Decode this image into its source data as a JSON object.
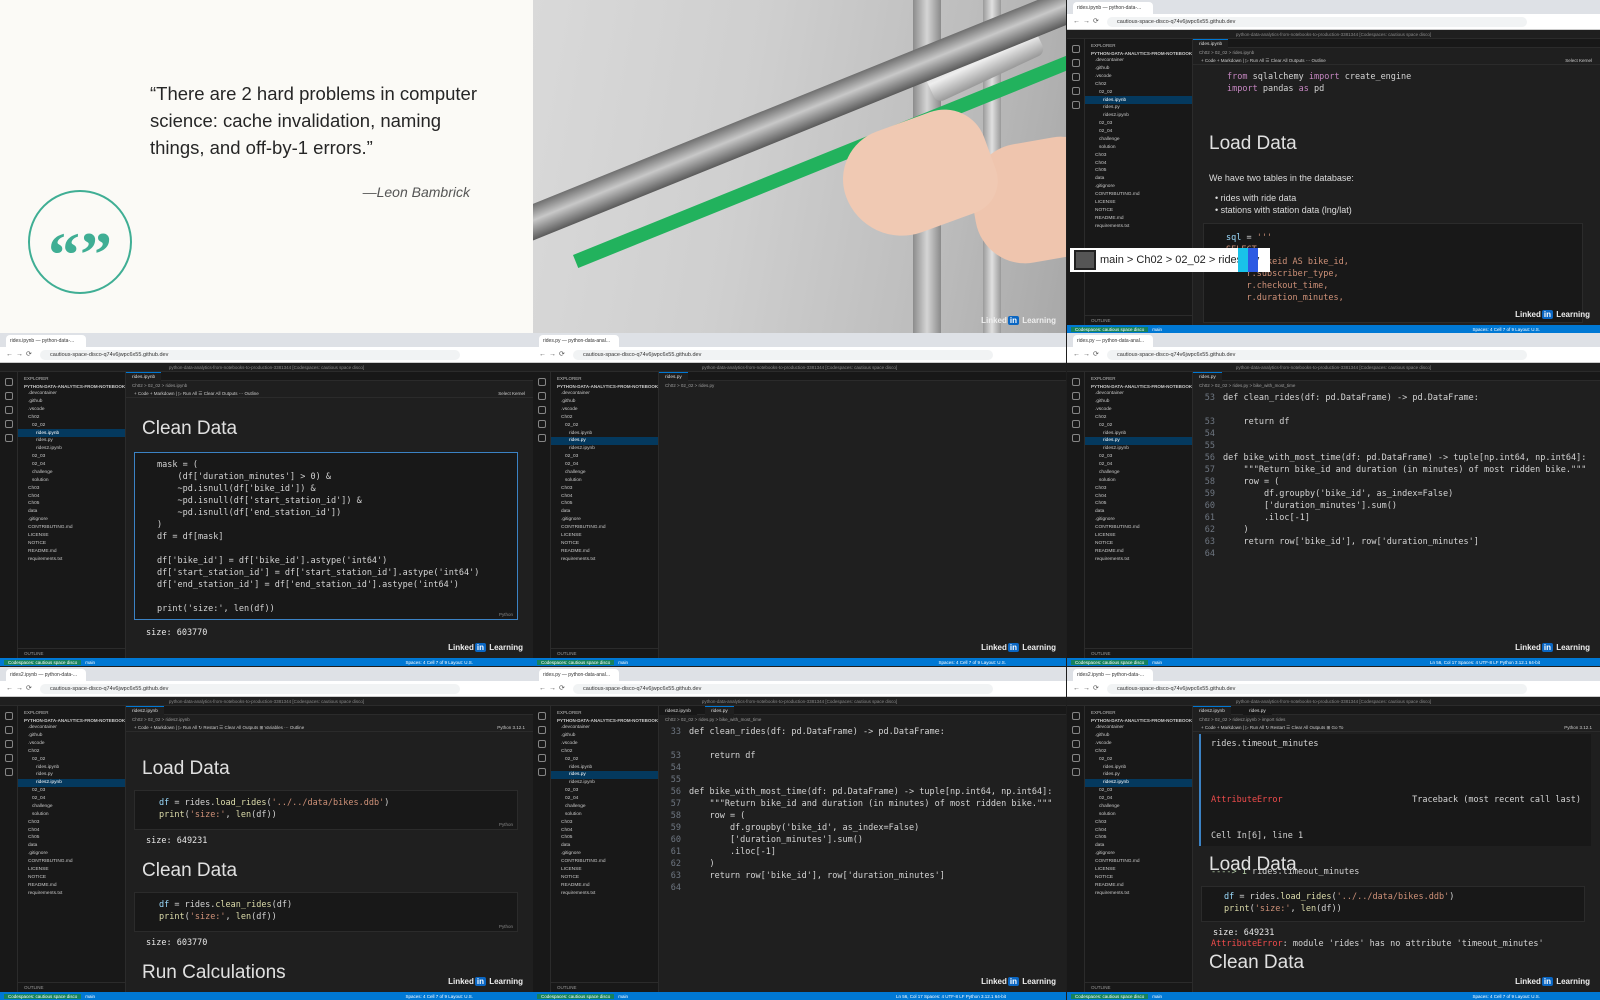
{
  "quote": {
    "text": "“There are 2 hard problems in computer science: cache invalidation, naming things, and off-by-1 errors.”",
    "author": "—Leon Bambrick",
    "badge": "“”"
  },
  "watermark": {
    "pre": "Linked",
    "in": "in",
    "post": " Learning"
  },
  "browser": {
    "url": "cautious-space-disco-q74v6jwpc6x55.github.dev",
    "tab_rides": "rides.ipynb — python-data-...",
    "tab_rides_py": "rides.py — python-data-anal...",
    "tab_rides2": "rides2.ipynb — python-data-...",
    "window_title": "python-data-analytics-from-notebooks-to-production-3381344 [Codespaces: cautious space disco]"
  },
  "explorer": {
    "header": "EXPLORER",
    "root": "PYTHON-DATA-ANALYTICS-FROM-NOTEBOOKS-T...",
    "items_a": [
      ".devcontainer",
      ".github",
      ".vscode",
      "Ch02",
      "02_02",
      "rides.ipynb",
      "rides.py",
      "rides2.ipynb",
      "02_03",
      "02_04",
      "challenge",
      "solution",
      "Ch03",
      "Ch04",
      "Ch05",
      "data",
      ".gitignore",
      "CONTRIBUTING.md",
      "LICENSE",
      "NOTICE",
      "README.md",
      "requirements.txt"
    ],
    "outline": "OUTLINE",
    "timeline": "TIMELINE"
  },
  "tiles": {
    "t2": {
      "tab": "rides.ipynb",
      "crumb": "Ch02 > 02_02 > rides.ipynb",
      "toolbar": "+ Code   + Markdown   |   ▷ Run All   ☰ Clear All Outputs   ⋯ Outline",
      "kernel": "Select Kernel",
      "code_import1": "from sqlalchemy import create_engine",
      "code_import2": "import pandas as pd",
      "heading": "Load Data",
      "para": "We have two tables in the database:",
      "bullet1": "rides with ride data",
      "bullet2": "stations with station data (lng/lat)",
      "sql1": "sql = '''",
      "sql2": "SELECT",
      "sql3": "r.bikeid AS bike_id,",
      "sql4": "r.subscriber_type,",
      "sql5": "r.checkout_time,",
      "sql6": "r.duration_minutes,",
      "tooltip": "main > Ch02 > 02_02 > rides.ipy"
    },
    "t3": {
      "tab": "rides.ipynb",
      "crumb": "Ch02 > 02_02 > rides.ipynb",
      "toolbar": "+ Code   + Markdown   |   ▷ Run All   ☰ Clear All Outputs   ⋯ Outline",
      "kernel": "Select Kernel",
      "heading": "Clean Data",
      "lines": [
        "mask = (",
        "    (df['duration_minutes'] > 0) &",
        "    ~pd.isnull(df['bike_id']) &",
        "    ~pd.isnull(df['start_station_id']) &",
        "    ~pd.isnull(df['end_station_id'])",
        ")",
        "df = df[mask]",
        "",
        "df['bike_id'] = df['bike_id'].astype('int64')",
        "df['start_station_id'] = df['start_station_id'].astype('int64')",
        "df['end_station_id'] = df['end_station_id'].astype('int64')",
        "",
        "print('size:', len(df))"
      ],
      "output": "size: 603770",
      "lang": "Python"
    },
    "t4": {
      "tab": "rides.py",
      "crumb": "Ch02 > 02_02 > rides.py"
    },
    "t5": {
      "tab": "rides.py",
      "crumb": "Ch02 > 02_02 > rides.py > bike_with_most_time",
      "lines": [
        {
          "n": "53",
          "c": "def clean_rides(df: pd.DataFrame) -> pd.DataFrame:"
        },
        {
          "n": "",
          "c": ""
        },
        {
          "n": "53",
          "c": "    return df"
        },
        {
          "n": "54",
          "c": ""
        },
        {
          "n": "55",
          "c": ""
        },
        {
          "n": "56",
          "c": "def bike_with_most_time(df: pd.DataFrame) -> tuple[np.int64, np.int64]:"
        },
        {
          "n": "57",
          "c": "    \"\"\"Return bike_id and duration (in minutes) of most ridden bike.\"\"\""
        },
        {
          "n": "58",
          "c": "    row = ("
        },
        {
          "n": "59",
          "c": "        df.groupby('bike_id', as_index=False)"
        },
        {
          "n": "60",
          "c": "        ['duration_minutes'].sum()"
        },
        {
          "n": "61",
          "c": "        .iloc[-1]"
        },
        {
          "n": "62",
          "c": "    )"
        },
        {
          "n": "63",
          "c": "    return row['bike_id'], row['duration_minutes']"
        },
        {
          "n": "64",
          "c": ""
        }
      ]
    },
    "t6": {
      "tab": "rides2.ipynb",
      "crumb": "Ch02 > 02_02 > rides2.ipynb",
      "toolbar": "+ Code   + Markdown   |   ▷ Run All   ↻ Restart   ☰ Clear All Outputs   ⊞ Variables   ⋯ Outline",
      "kernel": "Python 3.12.1",
      "h1": "Load Data",
      "c1a": "df = rides.load_rides('../../data/bikes.ddb')",
      "c1b": "print('size:', len(df))",
      "o1": "size: 649231",
      "h2": "Clean Data",
      "c2a": "df = rides.clean_rides(df)",
      "c2b": "print('size:', len(df))",
      "o2": "size: 603770",
      "h3": "Run Calculations",
      "lang": "Python"
    },
    "t7": {
      "tab1": "rides2.ipynb",
      "tab2": "rides.py",
      "crumb": "Ch02 > 02_02 > rides.py > bike_with_most_time",
      "lines": [
        {
          "n": "33",
          "c": "def clean_rides(df: pd.DataFrame) -> pd.DataFrame:"
        },
        {
          "n": "",
          "c": ""
        },
        {
          "n": "53",
          "c": "    return df"
        },
        {
          "n": "54",
          "c": ""
        },
        {
          "n": "55",
          "c": ""
        },
        {
          "n": "56",
          "c": "def bike_with_most_time(df: pd.DataFrame) -> tuple[np.int64, np.int64]:"
        },
        {
          "n": "57",
          "c": "    \"\"\"Return bike_id and duration (in minutes) of most ridden bike.\"\"\""
        },
        {
          "n": "58",
          "c": "    row = ("
        },
        {
          "n": "59",
          "c": "        df.groupby('bike_id', as_index=False)"
        },
        {
          "n": "60",
          "c": "        ['duration_minutes'].sum()"
        },
        {
          "n": "61",
          "c": "        .iloc[-1]"
        },
        {
          "n": "62",
          "c": "    )"
        },
        {
          "n": "63",
          "c": "    return row['bike_id'], row['duration_minutes']"
        },
        {
          "n": "64",
          "c": ""
        }
      ]
    },
    "t8": {
      "tab1": "rides2.ipynb",
      "tab2": "rides.py",
      "crumb": "Ch02 > 02_02 > rides2.ipynb > import rides",
      "toolbar": "+ Code   + Markdown   |   ▷ Run All   ↻ Restart   ☰ Clear All Outputs   ⊞ Go To",
      "kernel": "Python 3.12.1",
      "c0": "rides.timeout_minutes",
      "e1": "AttributeError",
      "e1r": "Traceback (most recent call last)",
      "e2": "Cell In[6], line 1",
      "e3": "----> 1 rides.timeout_minutes",
      "e4a": "AttributeError",
      "e4b": ": module 'rides' has no attribute 'timeout_minutes'",
      "h1": "Load Data",
      "c1a": "df = rides.load_rides('../../data/bikes.ddb')",
      "c1b": "print('size:', len(df))",
      "o1": "size: 649231",
      "h2": "Clean Data"
    }
  },
  "status": {
    "remote": "Codespaces: cautious space disco",
    "branch": "main",
    "right_nb": "Spaces: 4   Cell 7 of 9   Layout: U.S.",
    "right_py": "Ln 56, Col 17   Spaces: 4   UTF-8   LF   Python   3.12.1 64-bit"
  }
}
